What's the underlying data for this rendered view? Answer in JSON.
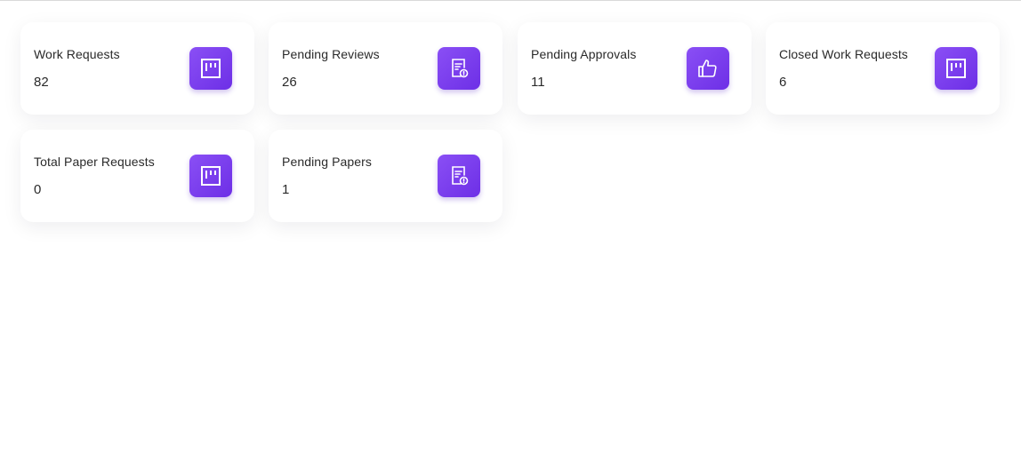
{
  "cards": [
    {
      "title": "Work Requests",
      "value": "82",
      "icon": "kanban-board-icon"
    },
    {
      "title": "Pending Reviews",
      "value": "26",
      "icon": "document-alert-icon"
    },
    {
      "title": "Pending Approvals",
      "value": "11",
      "icon": "thumbs-up-icon"
    },
    {
      "title": "Closed Work Requests",
      "value": "6",
      "icon": "kanban-board-icon"
    },
    {
      "title": "Total Paper Requests",
      "value": "0",
      "icon": "kanban-board-icon"
    },
    {
      "title": "Pending Papers",
      "value": "1",
      "icon": "document-alert-icon"
    }
  ],
  "colors": {
    "icon_gradient_start": "#8a4ff5",
    "icon_gradient_end": "#6d2fe6",
    "text": "#2a2a2a"
  }
}
